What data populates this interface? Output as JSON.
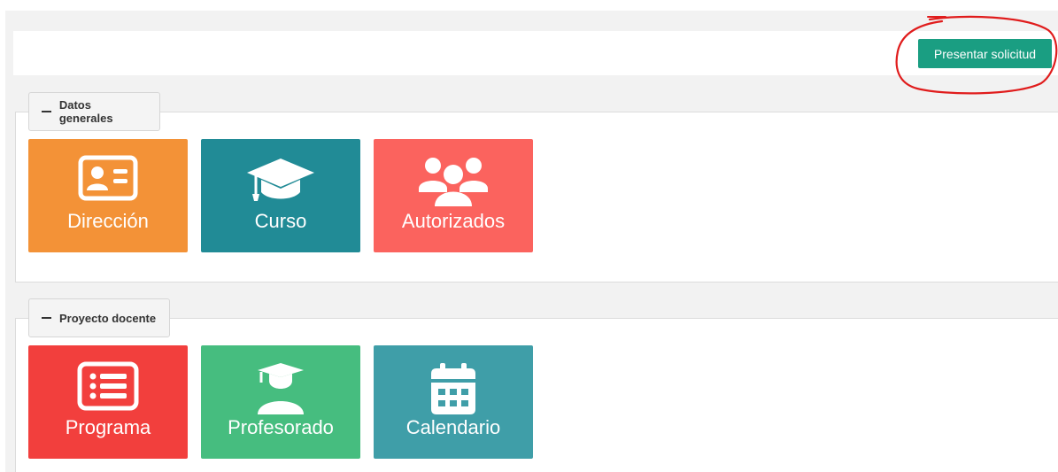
{
  "toolbar": {
    "submit_label": "Presentar solicitud"
  },
  "sections": [
    {
      "title": "Datos generales",
      "tiles": [
        {
          "label": "Dirección",
          "icon": "id-card-icon",
          "color": "#f39237"
        },
        {
          "label": "Curso",
          "icon": "graduation-cap-icon",
          "color": "#218b96"
        },
        {
          "label": "Autorizados",
          "icon": "users-icon",
          "color": "#fb635e"
        }
      ]
    },
    {
      "title": "Proyecto docente",
      "tiles": [
        {
          "label": "Programa",
          "icon": "list-icon",
          "color": "#f23f3d"
        },
        {
          "label": "Profesorado",
          "icon": "teacher-icon",
          "color": "#46bd7f"
        },
        {
          "label": "Calendario",
          "icon": "calendar-icon",
          "color": "#3f9ea8"
        }
      ]
    }
  ],
  "colors": {
    "accent": "#1a9e82",
    "annotation": "#e01c1c",
    "background": "#f2f2f2"
  }
}
